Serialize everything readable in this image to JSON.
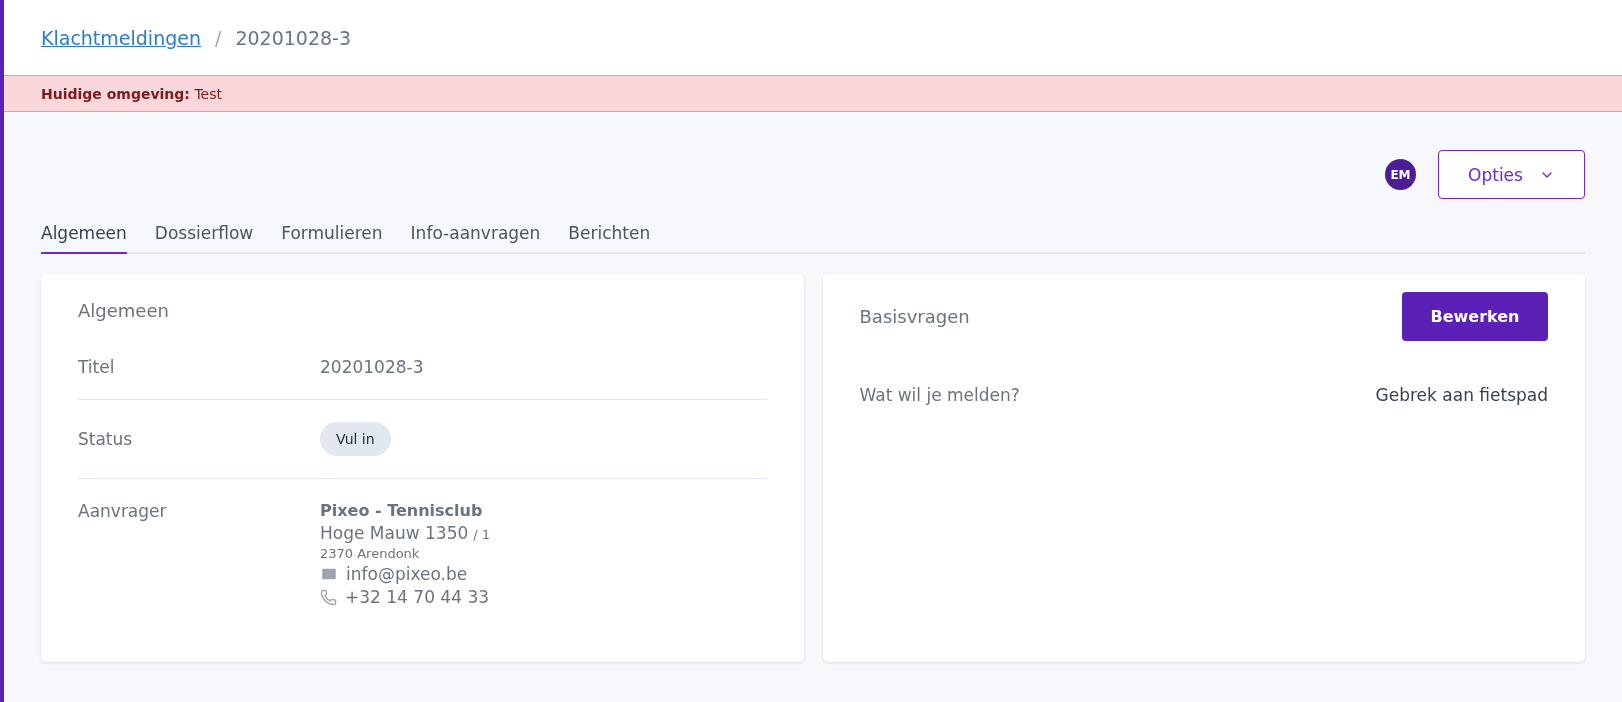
{
  "breadcrumb": {
    "link": "Klachtmeldingen",
    "separator": "/",
    "current": "20201028-3"
  },
  "environment_banner": {
    "label": "Huidige omgeving:",
    "value": "Test"
  },
  "user": {
    "initials": "EM"
  },
  "options_button": {
    "label": "Opties"
  },
  "tabs": [
    {
      "label": "Algemeen",
      "selected": true
    },
    {
      "label": "Dossierflow",
      "selected": false
    },
    {
      "label": "Formulieren",
      "selected": false
    },
    {
      "label": "Info-aanvragen",
      "selected": false
    },
    {
      "label": "Berichten",
      "selected": false
    }
  ],
  "general_card": {
    "title": "Algemeen",
    "rows": [
      {
        "kind": "text",
        "label": "Titel",
        "value": "20201028-3"
      },
      {
        "kind": "badge",
        "label": "Status",
        "value": "Vul in"
      },
      {
        "kind": "contact",
        "label": "Aanvrager",
        "name": "Pixeo - Tennisclub",
        "street": "Hoge Mauw 1350",
        "box": "/ 1",
        "city": "2370 Arendonk",
        "email": "info@pixeo.be",
        "phone": "+32 14 70 44 33"
      }
    ]
  },
  "questions_card": {
    "title": "Basisvragen",
    "edit_button": "Bewerken",
    "rows": [
      {
        "question": "Wat wil je melden?",
        "answer": "Gebrek aan fietspad"
      }
    ]
  }
}
